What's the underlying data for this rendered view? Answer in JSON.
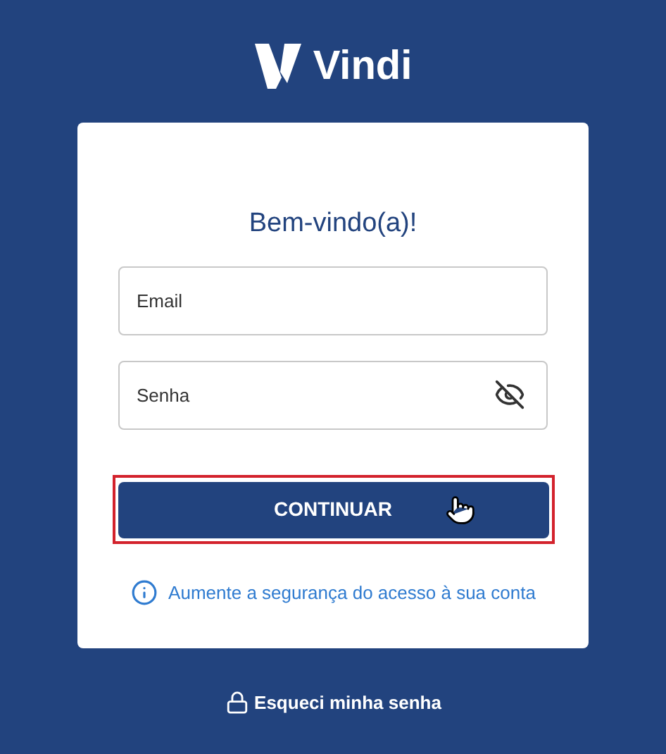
{
  "logo": {
    "text": "Vindi"
  },
  "card": {
    "title": "Bem-vindo(a)!",
    "fields": [
      {
        "placeholder": "Email",
        "kind": "text"
      },
      {
        "placeholder": "Senha",
        "kind": "password"
      }
    ],
    "button": {
      "label": "CONTINUAR",
      "highlighted": true
    },
    "security_link": "Aumente a segurança do acesso à sua conta"
  },
  "forgot_link": "Esqueci minha senha"
}
